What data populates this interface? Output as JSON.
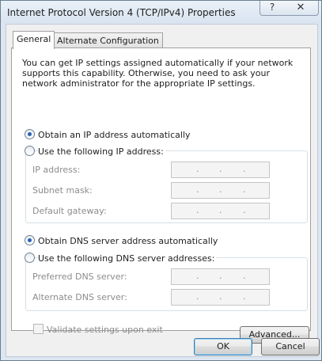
{
  "window": {
    "title": "Internet Protocol Version 4 (TCP/IPv4) Properties",
    "help_label": "?",
    "close_label": "✕"
  },
  "tabs": [
    {
      "label": "General",
      "active": true
    },
    {
      "label": "Alternate Configuration",
      "active": false
    }
  ],
  "general": {
    "description": "You can get IP settings assigned automatically if your network supports this capability. Otherwise, you need to ask your network administrator for the appropriate IP settings.",
    "ip_auto_label": "Obtain an IP address automatically",
    "ip_manual_label": "Use the following IP address:",
    "ip_address_label": "IP address:",
    "subnet_mask_label": "Subnet mask:",
    "default_gateway_label": "Default gateway:",
    "dns_auto_label": "Obtain DNS server address automatically",
    "dns_manual_label": "Use the following DNS server addresses:",
    "preferred_dns_label": "Preferred DNS server:",
    "alternate_dns_label": "Alternate DNS server:",
    "ip_separator": ".",
    "validate_label": "Validate settings upon exit",
    "advanced_label": "Advanced..."
  },
  "footer": {
    "ok_label": "OK",
    "cancel_label": "Cancel"
  }
}
